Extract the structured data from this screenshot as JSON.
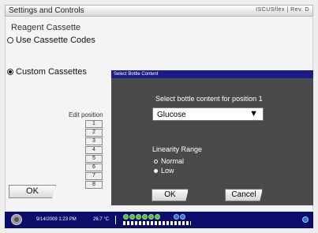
{
  "window": {
    "title": "Settings and Controls",
    "brand": "ISCUSflex | Rev. D"
  },
  "main": {
    "section_label": "Reagent Cassette",
    "options": [
      {
        "label": "Use Cassette Codes",
        "selected": false
      },
      {
        "label": "Custom Cassettes",
        "selected": true
      }
    ],
    "edit_position_label": "Edit position",
    "positions": [
      "1",
      "2",
      "3",
      "4",
      "5",
      "6",
      "7",
      "8"
    ],
    "ok_label": "OK"
  },
  "dialog": {
    "header": "Select Bottle Content",
    "prompt": "Select bottle content for position 1",
    "selected_content": "Glucose",
    "linearity_title": "Linearity Range",
    "linearity_options": [
      {
        "label": "Normal",
        "selected": false
      },
      {
        "label": "Low",
        "selected": true
      }
    ],
    "ok_label": "OK",
    "cancel_label": "Cancel"
  },
  "status": {
    "datetime": "9/14/2009 1:23 PM",
    "temperature": "26.7 °C",
    "cassette_colors": [
      "green",
      "green",
      "green",
      "green",
      "green",
      "green",
      "blue",
      "blue"
    ]
  },
  "icons": {
    "power": "power-icon",
    "dropdown": "chevron-down-icon",
    "network": "globe-icon"
  }
}
